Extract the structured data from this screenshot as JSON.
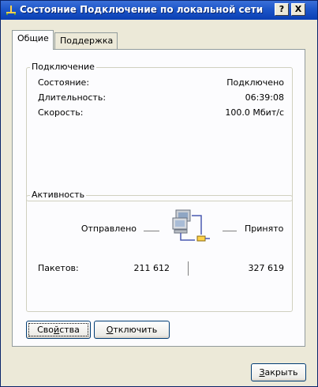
{
  "window": {
    "title": "Состояние Подключение по локальной сети",
    "help_label": "?",
    "close_label": "X"
  },
  "tabs": [
    {
      "label": "Общие",
      "active": true
    },
    {
      "label": "Поддержка",
      "active": false
    }
  ],
  "connection": {
    "legend": "Подключение",
    "rows": [
      {
        "label": "Состояние:",
        "value": "Подключено"
      },
      {
        "label": "Длительность:",
        "value": "06:39:08"
      },
      {
        "label": "Скорость:",
        "value": "100.0 Мбит/с"
      }
    ]
  },
  "activity": {
    "legend": "Активность",
    "sent_label": "Отправлено",
    "received_label": "Принято",
    "packets_label": "Пакетов:",
    "packets_sent": "211 612",
    "packets_received": "327 619"
  },
  "buttons": {
    "properties_pre": "Сво",
    "properties_ul": "й",
    "properties_post": "ства",
    "disconnect_ul": "О",
    "disconnect_post": "тключить",
    "close_ul": "З",
    "close_post": "акрыть"
  },
  "icons": {
    "title": "network-connection-icon",
    "activity": "network-computers-icon"
  }
}
